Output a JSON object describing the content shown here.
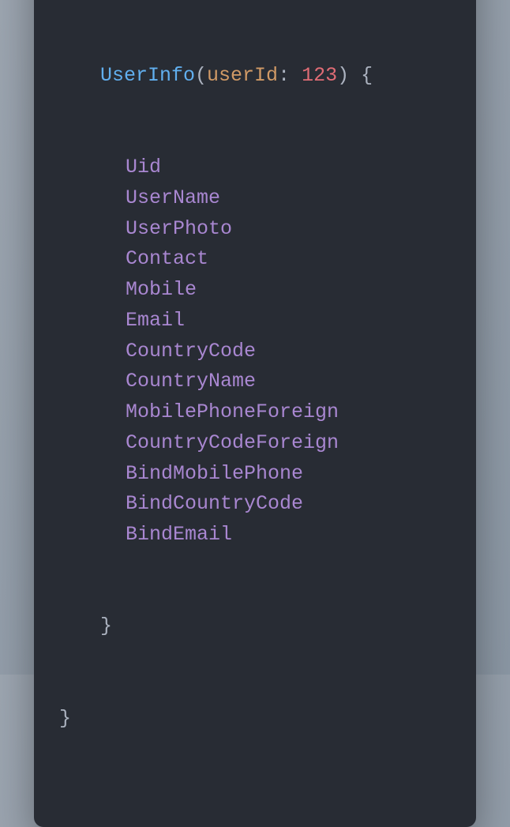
{
  "window": {
    "controls": {
      "close": "red",
      "minimize": "yellow",
      "zoom": "green"
    }
  },
  "code": {
    "braceOpen": "{",
    "braceClose": "}",
    "parenOpen": "(",
    "parenClose": ")",
    "colon": ":",
    "space": " ",
    "callName": "UserInfo",
    "paramName": "userId",
    "paramValue": "123",
    "fields": [
      "Uid",
      "UserName",
      "UserPhoto",
      "Contact",
      "Mobile",
      "Email",
      "CountryCode",
      "CountryName",
      "MobilePhoneForeign",
      "CountryCodeForeign",
      "BindMobilePhone",
      "BindCountryCode",
      "BindEmail"
    ]
  }
}
